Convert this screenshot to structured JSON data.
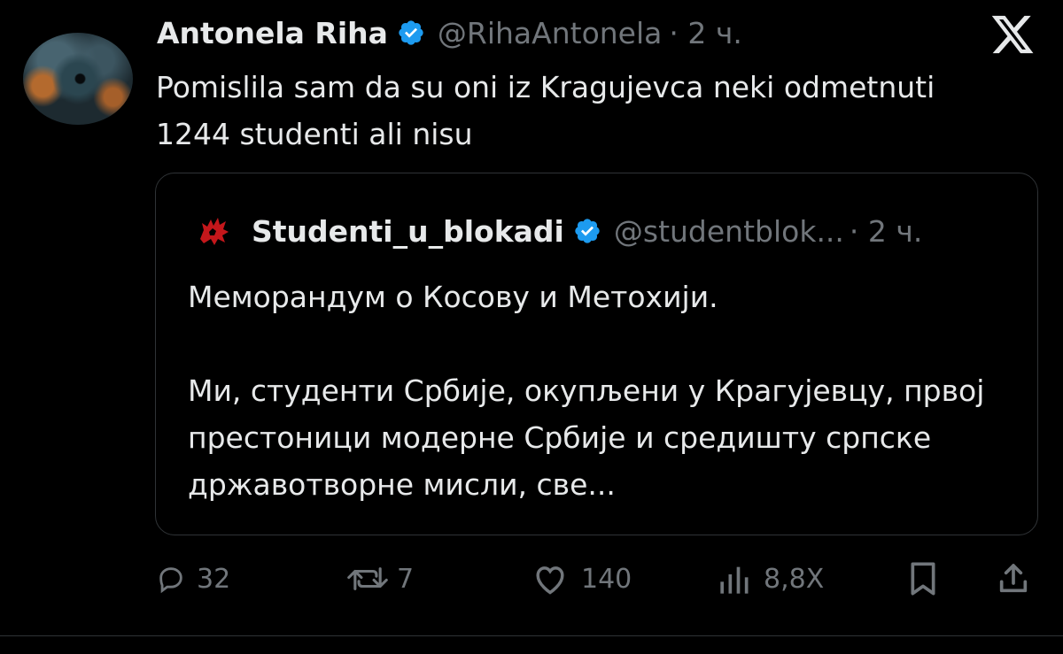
{
  "tweet": {
    "author_name": "Antonela Riha",
    "author_handle": "@RihaAntonela",
    "time": "· 2 ч.",
    "text": "Pomislila sam da su oni iz Kragujevca neki odmetnuti 1244 studenti ali nisu",
    "avatar_icon": "nebula-eye-avatar",
    "verified_icon": "verified-badge-icon"
  },
  "quote": {
    "author_name": "Studenti_u_blokadi",
    "author_handle": "@studentblok...",
    "time": "· 2 ч.",
    "text": "Меморандум о Косову и Метохији.\n\nМи, студенти Србије, окупљени у Крагујевцу, првој престоници модерне Србије и средишту српске државотворне мисли, све..."
  },
  "actions": {
    "replies": "32",
    "reposts": "7",
    "likes": "140",
    "views": "8,8Х"
  },
  "colors": {
    "background": "#000000",
    "text": "#e7e9ea",
    "muted": "#71767b",
    "verified": "#1d9bf0",
    "border": "#2f3336",
    "quote_avatar": "#c4171b"
  }
}
